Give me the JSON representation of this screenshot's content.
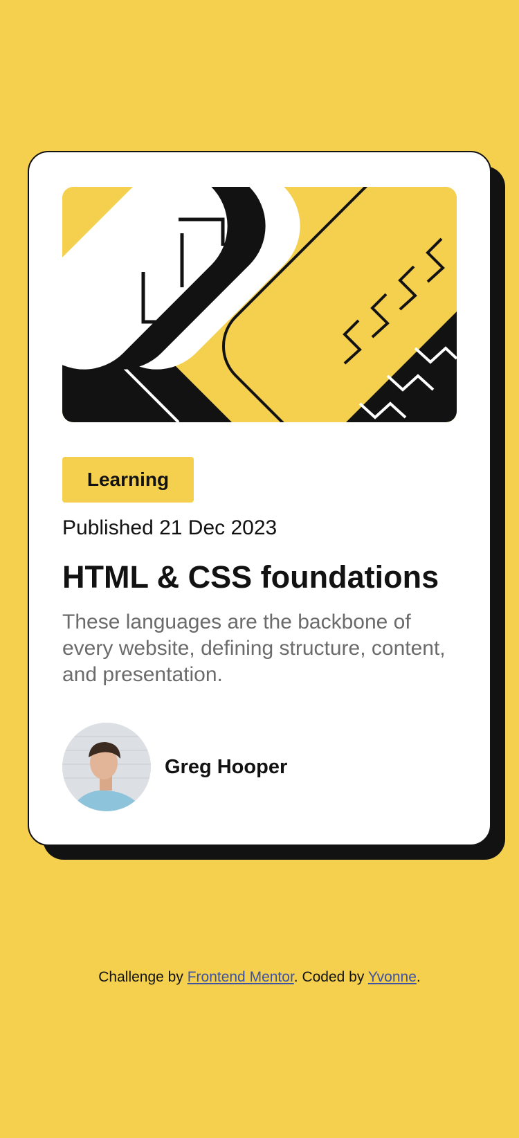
{
  "page": {
    "background_color": "#F4D04E",
    "accent_color": "#F4D04E",
    "text_color": "#121212",
    "muted_text_color": "#6B6B6B",
    "link_color": "#3E52A3"
  },
  "card": {
    "hero_image": "illustration-article",
    "tag": "Learning",
    "published": "Published 21 Dec 2023",
    "title": "HTML & CSS foundations",
    "description": "These languages are the backbone of every website, defining structure, content, and presentation.",
    "author": {
      "avatar": "avatar-photo",
      "name": "Greg Hooper"
    }
  },
  "attribution": {
    "prefix": "Challenge by ",
    "link1": "Frontend Mentor",
    "middle": ". Coded by ",
    "link2": "Yvonne",
    "suffix": "."
  }
}
